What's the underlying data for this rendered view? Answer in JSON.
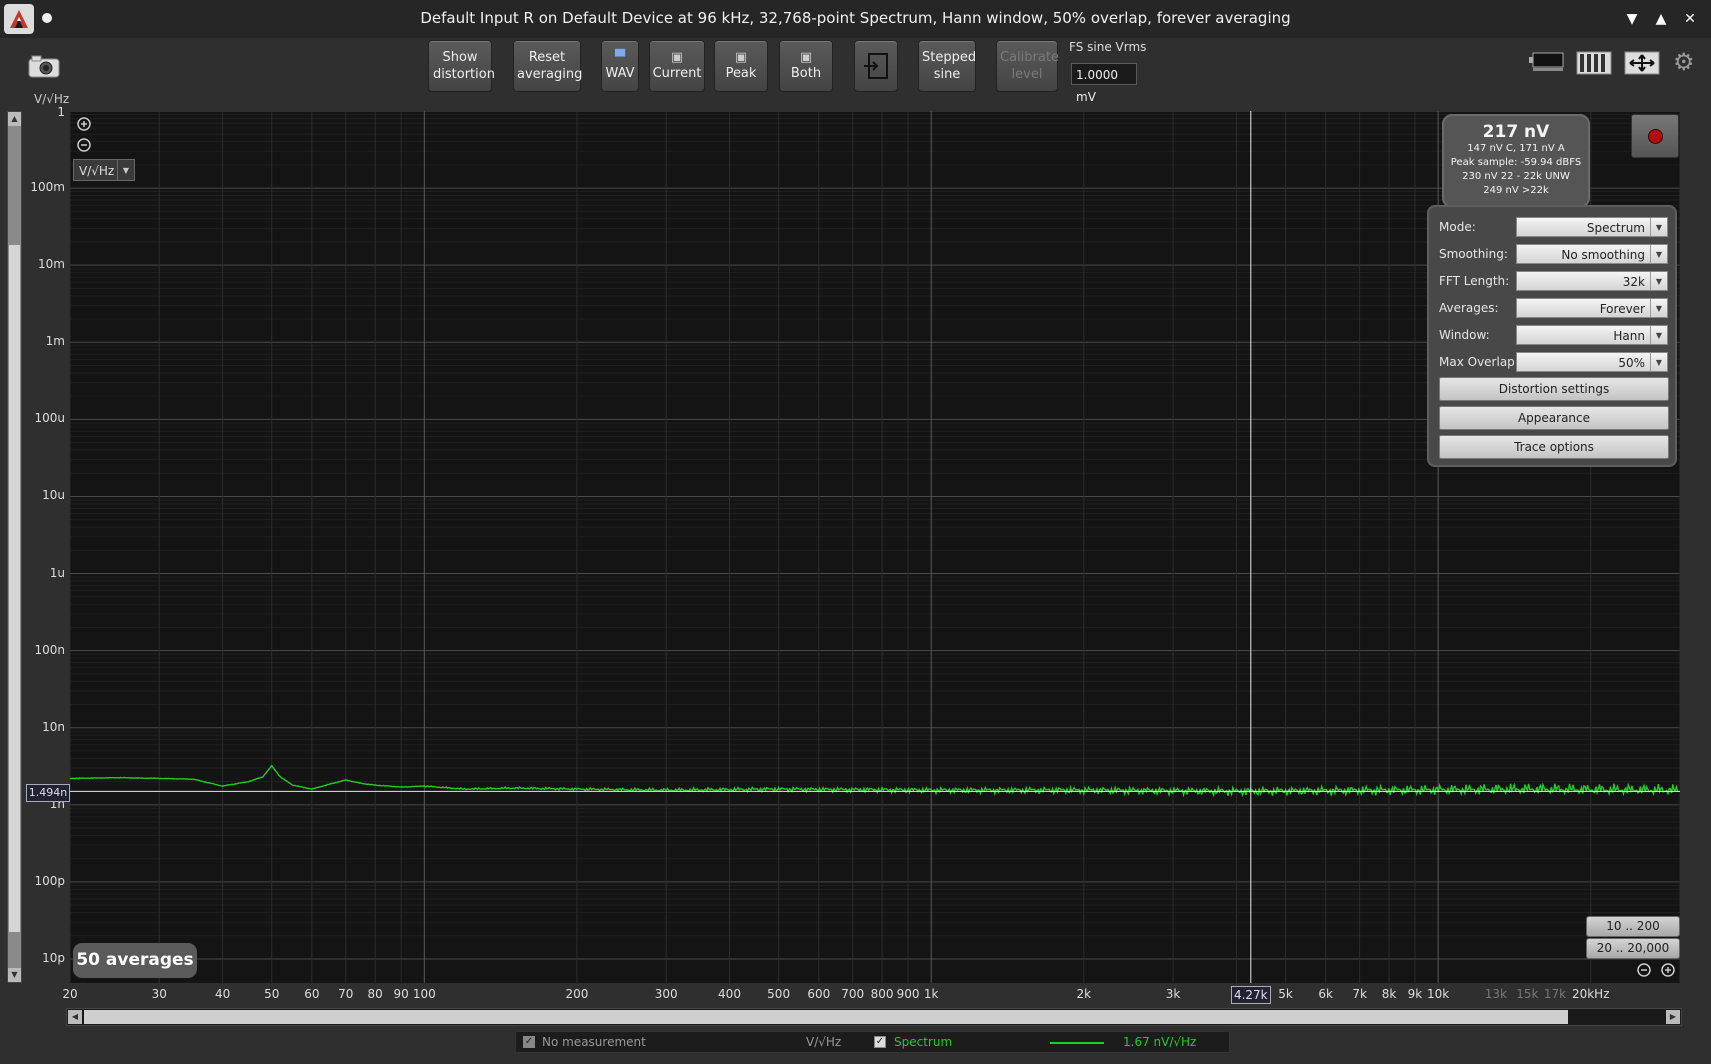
{
  "window": {
    "title": "Default Input R on Default Device at 96 kHz, 32,768-point Spectrum, Hann window, 50% overlap, forever averaging",
    "controls": [
      "▼",
      "▲",
      "✕"
    ]
  },
  "toolbar": {
    "show_distortion": "Show distortion",
    "reset_averaging": "Reset averaging",
    "wav": "WAV",
    "current": "Current",
    "peak": "Peak",
    "both": "Both",
    "stepped_sine": "Stepped sine",
    "calibrate_level": "Calibrate level",
    "fs_label": "FS sine Vrms",
    "fs_value": "1.0000 mV"
  },
  "graph": {
    "y_unit": "V/√Hz",
    "unit_select": "V/√Hz",
    "cursor_x_value": "4.27k",
    "cursor_y_value": "1.494n",
    "averages_badge": "50 averages"
  },
  "readout": {
    "main": "217 nV",
    "line1": "147 nV C, 171 nV A",
    "line2": "Peak sample: -59.94 dBFS",
    "line3": "230 nV 22 - 22k UNW",
    "line4": "249 nV >22k"
  },
  "settings": {
    "mode_label": "Mode:",
    "mode_value": "Spectrum",
    "smoothing_label": "Smoothing:",
    "smoothing_value": "No smoothing",
    "fft_label": "FFT Length:",
    "fft_value": "32k",
    "averages_label": "Averages:",
    "averages_value": "Forever",
    "window_label": "Window:",
    "window_value": "Hann",
    "overlap_label": "Max Overlap:",
    "overlap_value": "50%",
    "distortion_settings": "Distortion settings",
    "appearance": "Appearance",
    "trace_options": "Trace options"
  },
  "range_buttons": {
    "r1": "10 .. 200",
    "r2": "20 .. 20,000"
  },
  "legend": {
    "no_measurement": "No measurement",
    "unit": "V/√Hz",
    "spectrum": "Spectrum",
    "value": "1.67 nV/√Hz"
  },
  "chart_data": {
    "type": "line",
    "xscale": "log",
    "yscale": "log",
    "xlim": [
      20,
      30000
    ],
    "ylim": [
      1e-11,
      1
    ],
    "ylabel": "V/√Hz",
    "y_ticks": [
      {
        "v": 1,
        "label": "1"
      },
      {
        "v": 0.1,
        "label": "100m"
      },
      {
        "v": 0.01,
        "label": "10m"
      },
      {
        "v": 0.001,
        "label": "1m"
      },
      {
        "v": 0.0001,
        "label": "100u"
      },
      {
        "v": 1e-05,
        "label": "10u"
      },
      {
        "v": 1e-06,
        "label": "1u"
      },
      {
        "v": 1e-07,
        "label": "100n"
      },
      {
        "v": 1e-08,
        "label": "10n"
      },
      {
        "v": 1e-09,
        "label": "1n"
      },
      {
        "v": 1e-10,
        "label": "100p"
      },
      {
        "v": 1e-11,
        "label": "10p"
      }
    ],
    "x_ticks": [
      {
        "v": 20,
        "label": "20"
      },
      {
        "v": 30,
        "label": "30"
      },
      {
        "v": 40,
        "label": "40"
      },
      {
        "v": 50,
        "label": "50"
      },
      {
        "v": 60,
        "label": "60"
      },
      {
        "v": 70,
        "label": "70"
      },
      {
        "v": 80,
        "label": "80"
      },
      {
        "v": 90,
        "label": "90"
      },
      {
        "v": 100,
        "label": "100"
      },
      {
        "v": 200,
        "label": "200"
      },
      {
        "v": 300,
        "label": "300"
      },
      {
        "v": 400,
        "label": "400"
      },
      {
        "v": 500,
        "label": "500"
      },
      {
        "v": 600,
        "label": "600"
      },
      {
        "v": 700,
        "label": "700"
      },
      {
        "v": 800,
        "label": "800"
      },
      {
        "v": 900,
        "label": "900"
      },
      {
        "v": 1000,
        "label": "1k"
      },
      {
        "v": 2000,
        "label": "2k"
      },
      {
        "v": 3000,
        "label": "3k"
      },
      {
        "v": 5000,
        "label": "5k"
      },
      {
        "v": 6000,
        "label": "6k"
      },
      {
        "v": 7000,
        "label": "7k"
      },
      {
        "v": 8000,
        "label": "8k"
      },
      {
        "v": 9000,
        "label": "9k"
      },
      {
        "v": 10000,
        "label": "10k"
      },
      {
        "v": 13000,
        "label": "13k",
        "dim": true
      },
      {
        "v": 15000,
        "label": "15k",
        "dim": true
      },
      {
        "v": 17000,
        "label": "17k",
        "dim": true
      },
      {
        "v": 20000,
        "label": "20kHz"
      }
    ],
    "cursor_x": 4270,
    "cursor_y": 1.494e-09,
    "series": [
      {
        "name": "Spectrum",
        "color": "#22cc22",
        "points": [
          [
            20,
            2.2e-09
          ],
          [
            25,
            2.25e-09
          ],
          [
            30,
            2.2e-09
          ],
          [
            35,
            2.15e-09
          ],
          [
            40,
            1.75e-09
          ],
          [
            45,
            2e-09
          ],
          [
            48,
            2.3e-09
          ],
          [
            50,
            3.2e-09
          ],
          [
            52,
            2.3e-09
          ],
          [
            55,
            1.8e-09
          ],
          [
            60,
            1.6e-09
          ],
          [
            65,
            1.85e-09
          ],
          [
            70,
            2.1e-09
          ],
          [
            75,
            1.9e-09
          ],
          [
            80,
            1.8e-09
          ],
          [
            90,
            1.7e-09
          ],
          [
            100,
            1.75e-09
          ],
          [
            120,
            1.6e-09
          ],
          [
            150,
            1.65e-09
          ],
          [
            200,
            1.6e-09
          ],
          [
            300,
            1.55e-09
          ],
          [
            500,
            1.6e-09
          ],
          [
            1000,
            1.55e-09
          ],
          [
            2000,
            1.55e-09
          ],
          [
            4000,
            1.5e-09
          ],
          [
            8000,
            1.55e-09
          ],
          [
            15000,
            1.6e-09
          ],
          [
            30000,
            1.55e-09
          ]
        ]
      }
    ]
  }
}
